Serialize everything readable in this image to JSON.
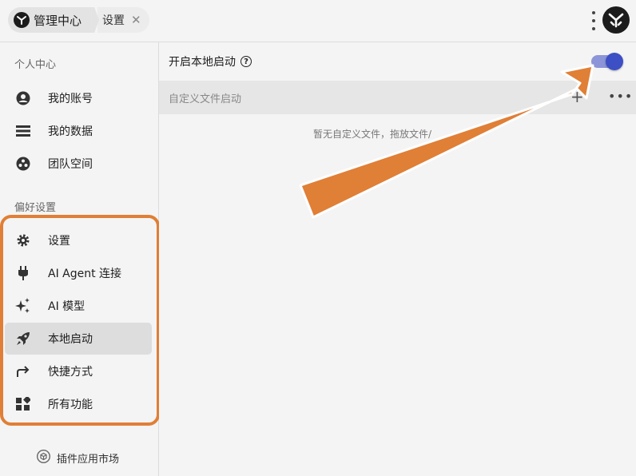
{
  "window": {
    "tab_main": "管理中心",
    "tab_sub": "设置",
    "tab_close": "✕"
  },
  "sidebar": {
    "section_personal": "个人中心",
    "personal_items": [
      {
        "label": "我的账号",
        "icon": "account-circle-icon"
      },
      {
        "label": "我的数据",
        "icon": "data-list-icon"
      },
      {
        "label": "团队空间",
        "icon": "team-icon"
      }
    ],
    "section_pref": "偏好设置",
    "pref_items": [
      {
        "label": "设置",
        "icon": "gear-icon"
      },
      {
        "label": "AI Agent 连接",
        "icon": "plug-icon"
      },
      {
        "label": "AI 模型",
        "icon": "sparkle-icon"
      },
      {
        "label": "本地启动",
        "icon": "rocket-icon",
        "active": true
      },
      {
        "label": "快捷方式",
        "icon": "share-arrow-icon"
      },
      {
        "label": "所有功能",
        "icon": "widgets-icon"
      }
    ],
    "market_label": "插件应用市场"
  },
  "main": {
    "enable_label": "开启本地启动",
    "help_glyph": "?",
    "toggle_on": true,
    "custom_label": "自定义文件启动",
    "add_glyph": "+",
    "more_glyph": "•••",
    "empty_text": "暂无自定义文件，拖放文件/"
  },
  "colors": {
    "accent": "#3d4fc4",
    "highlight": "#e07f36",
    "active_bg": "#dddddd"
  }
}
